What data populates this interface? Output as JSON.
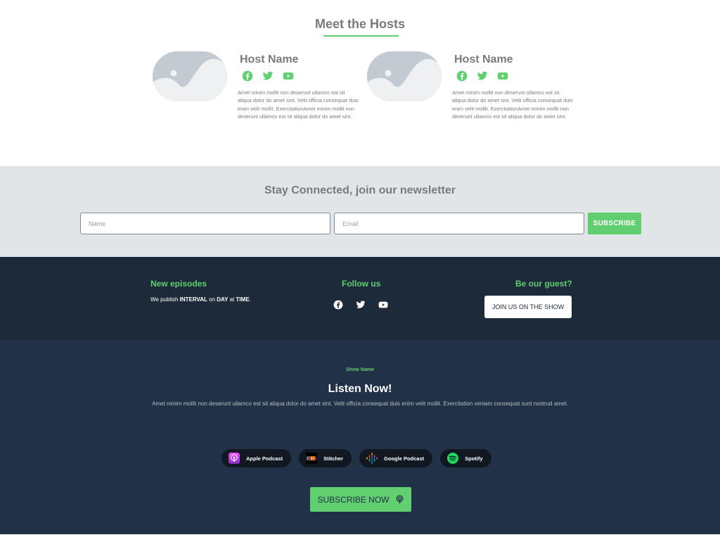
{
  "hosts_section": {
    "title": "Meet the Hosts",
    "hosts": [
      {
        "name": "Host Name",
        "socials": [
          "facebook-icon",
          "twitter-icon",
          "youtube-icon"
        ],
        "bio": "Amet minim mollit non deserunt ullamco est sit aliqua dolor do amet sint. Velit officia consequat duis enim velit mollit. ExercitationAmet minim mollit non deserunt ullamco est sit aliqua dolor do amet sint."
      },
      {
        "name": "Host Name",
        "socials": [
          "facebook-icon",
          "twitter-icon",
          "youtube-icon"
        ],
        "bio": "Amet minim mollit non deserunt ullamco est sit aliqua dolor do amet sint. Velit officia consequat duis enim velit mollit. ExercitationAmet minim mollit non deserunt ullamco est sit aliqua dolor do amet sint."
      }
    ]
  },
  "newsletter": {
    "title": "Stay Connected, join our newsletter",
    "name_placeholder": "Name",
    "email_placeholder": "Email",
    "subscribe_label": "SUBSCRIBE"
  },
  "info": {
    "new_episodes": {
      "heading": "New episodes",
      "prefix": "We publish ",
      "interval": "INTERVAL",
      "on": " on ",
      "day": "DAY",
      "at": " at ",
      "time": "TIME",
      "suffix": "."
    },
    "follow": {
      "heading": "Follow us",
      "icons": [
        "facebook-icon",
        "twitter-icon",
        "youtube-icon"
      ]
    },
    "guest": {
      "heading": "Be our guest?",
      "button_label": "JOIN US ON THE SHOW"
    }
  },
  "listen": {
    "show_name": "Show Name",
    "title": "Listen Now!",
    "description": "Amet minim mollit non deserunt ullamco est sit aliqua dolor do amet sint. Velit officia consequat duis enim velit mollit. Exercitation veniam consequat sunt nostrud amet.",
    "platforms": [
      {
        "label": "Apple Podcast",
        "icon": "apple-podcast-icon"
      },
      {
        "label": "Stitcher",
        "icon": "stitcher-icon"
      },
      {
        "label": "Google Podcast",
        "icon": "google-podcast-icon"
      },
      {
        "label": "Spotify",
        "icon": "spotify-icon"
      }
    ],
    "subscribe_now_label": "SUBSCRIBE NOW"
  },
  "colors": {
    "accent": "#61ce70",
    "dark_navy": "#1d2a3a",
    "navy": "#213147",
    "light_gray": "#e1e5e8",
    "text_gray": "#7a7a7a"
  }
}
